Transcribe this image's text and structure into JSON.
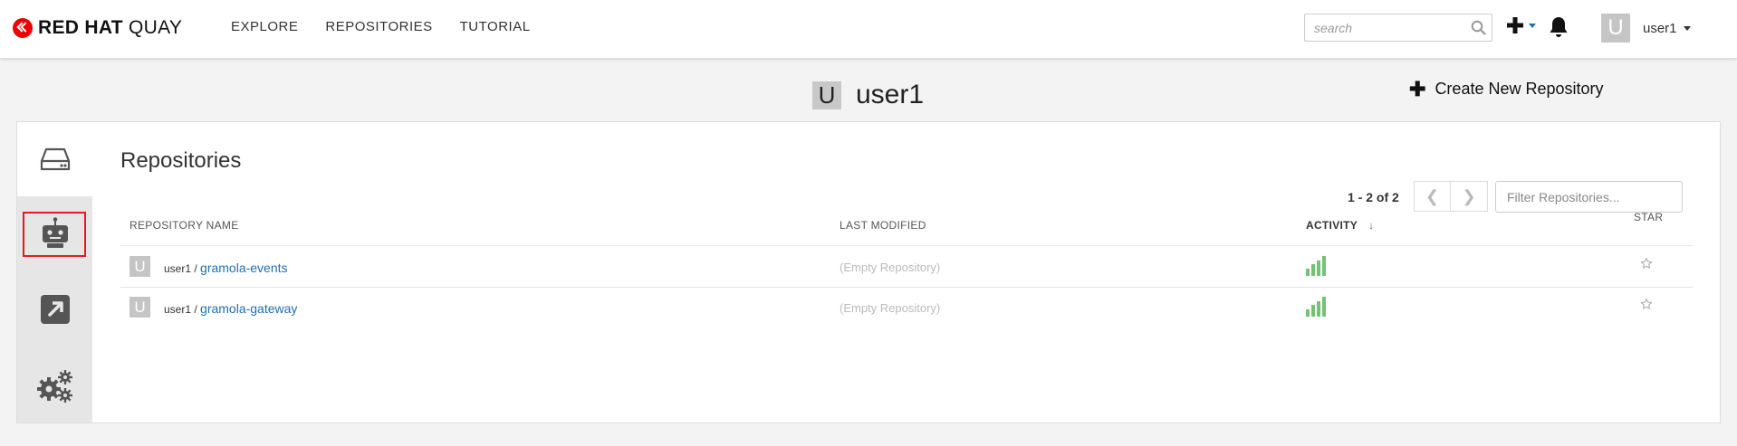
{
  "brand": {
    "bold": "RED HAT",
    "light": "QUAY"
  },
  "nav": {
    "items": [
      "EXPLORE",
      "REPOSITORIES",
      "TUTORIAL"
    ]
  },
  "search": {
    "placeholder": "search"
  },
  "user": {
    "name": "user1",
    "initial": "U"
  },
  "page": {
    "title": "user1",
    "avatar_initial": "U",
    "create_label": "Create New Repository"
  },
  "sidebar": {
    "items": [
      {
        "icon": "repository-drive-icon",
        "active": true
      },
      {
        "icon": "robot-icon",
        "highlighted": true
      },
      {
        "icon": "external-link-icon"
      },
      {
        "icon": "settings-gears-icon"
      }
    ],
    "highlight_color": "#e31b23"
  },
  "repositories": {
    "title": "Repositories",
    "pagination": {
      "range_label": "1 - 2 of 2",
      "prev": "❮",
      "next": "❯"
    },
    "filter_placeholder": "Filter Repositories...",
    "columns": {
      "name": "REPOSITORY NAME",
      "modified": "LAST MODIFIED",
      "activity": "ACTIVITY",
      "star": "STAR",
      "sort_indicator": "↓"
    },
    "rows": [
      {
        "namespace": "user1 /",
        "name": "gramola-events",
        "initial": "U",
        "last_modified": "(Empty Repository)"
      },
      {
        "namespace": "user1 /",
        "name": "gramola-gateway",
        "initial": "U",
        "last_modified": "(Empty Repository)"
      }
    ]
  },
  "colors": {
    "link": "#1f6fb5",
    "activity": "#5cb85c",
    "logo_red": "#ee0000"
  }
}
